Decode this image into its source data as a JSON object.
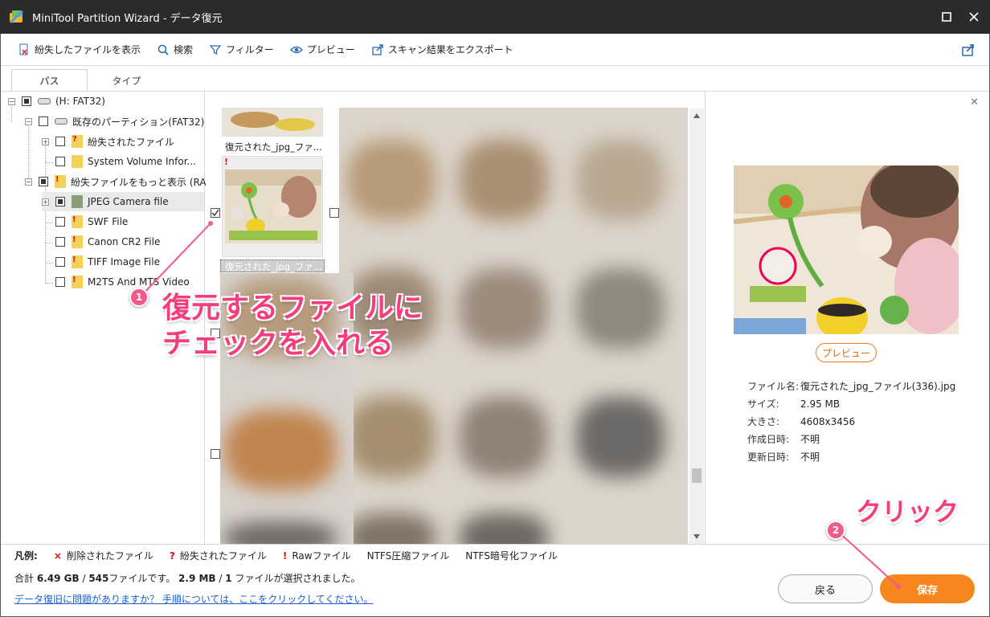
{
  "window": {
    "title": "MiniTool Partition Wizard - データ復元"
  },
  "toolbar": {
    "show_lost": "紛失したファイルを表示",
    "search": "検索",
    "filter": "フィルター",
    "preview": "プレビュー",
    "export": "スキャン結果をエクスポート"
  },
  "tabs": {
    "path": "パス",
    "type": "タイプ"
  },
  "tree": {
    "root": "(H: FAT32)",
    "partition": "既存のパーティション(FAT32)",
    "lost_files": "紛失されたファイル",
    "system_volume": "System Volume Infor...",
    "more_lost": "紛失ファイルをもっと表示 (RA...",
    "jpeg": "JPEG Camera file",
    "swf": "SWF File",
    "cr2": "Canon CR2 File",
    "tiff": "TIFF Image File",
    "m2ts": "M2TS And MTS Video"
  },
  "grid": {
    "label_top": "復元された_jpg_ファ...",
    "label_selected": "復元された_jpg_ファ..."
  },
  "preview": {
    "button": "プレビュー",
    "filename_key": "ファイル名:",
    "filename_val": "復元された_jpg_ファイル(336).jpg",
    "size_key": "サイズ:",
    "size_val": "2.95 MB",
    "dims_key": "大きさ:",
    "dims_val": "4608x3456",
    "created_key": "作成日時:",
    "created_val": "不明",
    "modified_key": "更新日時:",
    "modified_val": "不明"
  },
  "legend": {
    "title": "凡例:",
    "deleted": "削除されたファイル",
    "lost": "紛失されたファイル",
    "raw": "Rawファイル",
    "ntfs_comp": "NTFS圧縮ファイル",
    "ntfs_enc": "NTFS暗号化ファイル"
  },
  "summary": {
    "prefix": "合計",
    "total_size": "6.49 GB",
    "sep1": "/",
    "file_count": "545",
    "mid": "ファイルです。",
    "sel_size": "2.9 MB",
    "sep2": "/",
    "sel_count": "1",
    "suffix": "ファイルが選択されました。"
  },
  "help_link": "データ復旧に問題がありますか？ 手順については、ここをクリックしてください。",
  "buttons": {
    "back": "戻る",
    "save": "保存"
  },
  "annotations": {
    "step1_num": "1",
    "step1_line1": "復元するファイルに",
    "step1_line2": "チェックを入れる",
    "step2_num": "2",
    "step2_text": "クリック"
  },
  "colors": {
    "accent": "#f7861e",
    "annotation": "#f43d7d",
    "titlebar": "#2b2b2b",
    "link": "#1a5fd0"
  }
}
